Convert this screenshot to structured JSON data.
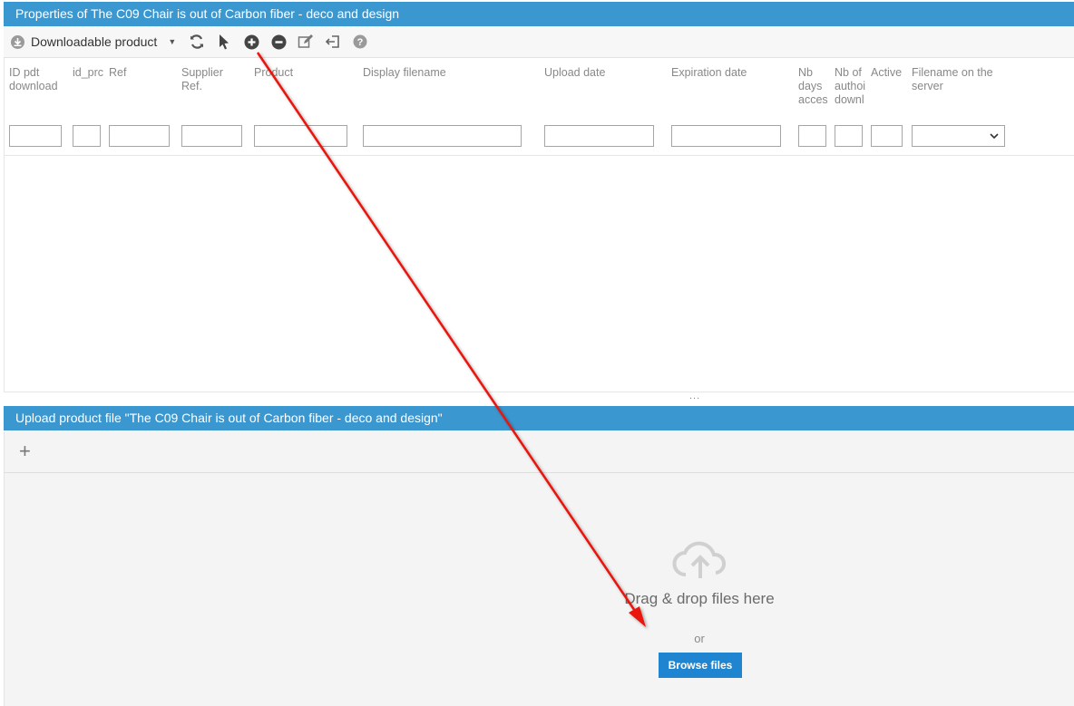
{
  "top_panel": {
    "title": "Properties of The C09 Chair is out of Carbon fiber - deco and design"
  },
  "toolbar": {
    "dropdown_label": "Downloadable product",
    "buttons": [
      "refresh-icon",
      "select-cursor-icon",
      "add-circle-icon",
      "remove-circle-icon",
      "edit-icon",
      "exit-icon",
      "help-icon"
    ]
  },
  "grid": {
    "columns": [
      {
        "label": "ID pdt download"
      },
      {
        "label": "id_prc"
      },
      {
        "label": "Ref"
      },
      {
        "label": "Supplier Ref."
      },
      {
        "label": "Product"
      },
      {
        "label": "Display filename"
      },
      {
        "label": "Upload date"
      },
      {
        "label": "Expiration date"
      },
      {
        "label": "Nb days acces"
      },
      {
        "label": "Nb of authoi downl"
      },
      {
        "label": "Active"
      },
      {
        "label": "Filename on the server"
      }
    ],
    "splitter": "..."
  },
  "upload_panel": {
    "title": "Upload product file \"The C09 Chair is out of Carbon fiber - deco and design\"",
    "add_label": "+",
    "drop_text": "Drag & drop files here",
    "or_text": "or",
    "browse_label": "Browse files"
  },
  "colors": {
    "header_blue": "#3b97cf",
    "browse_blue": "#1f85d0",
    "annotation_arrow": "#e8120c"
  }
}
